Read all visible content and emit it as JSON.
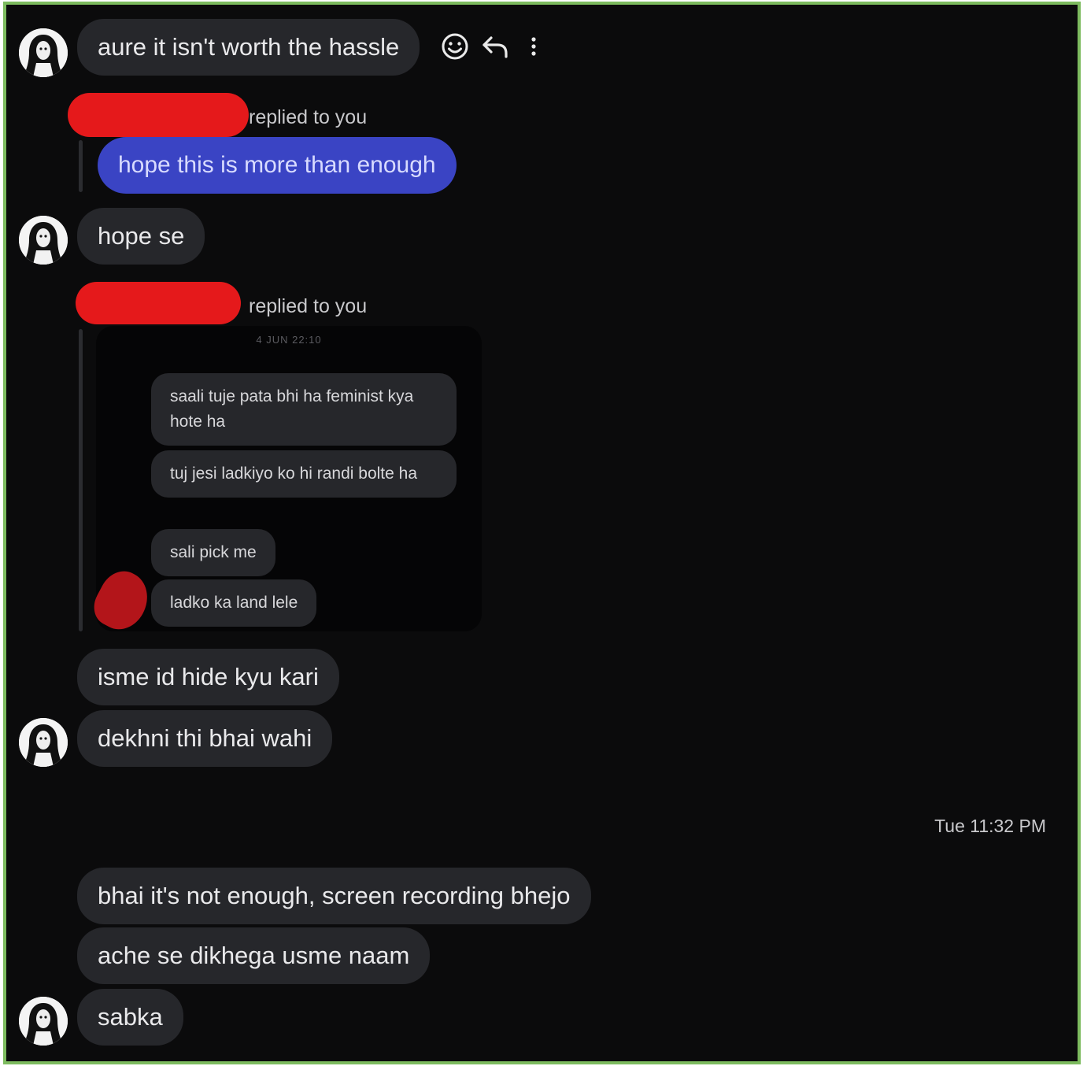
{
  "messages": {
    "m1": "aure it isn't worth the hassle",
    "reply1_label": "replied to you",
    "reply1_text": "hope this is more than enough",
    "m2": "hope se",
    "reply2_label": "replied to you",
    "m3": "isme id hide kyu kari",
    "m4": "dekhni thi bhai wahi",
    "m5": "bhai it's not enough, screen recording bhejo",
    "m6": "ache se dikhega usme naam",
    "m7": "sabka"
  },
  "quoted_screenshot": {
    "stamp": "4 JUN 22:10",
    "q1": "saali tuje pata bhi ha feminist kya hote ha",
    "q2": "tuj jesi ladkiyo ko hi randi bolte ha",
    "q3": "sali pick me",
    "q4": "ladko ka land lele"
  },
  "timestamp": "Tue 11:32 PM",
  "icons": {
    "react": "smiley-icon",
    "reply": "reply-arrow-icon",
    "more": "more-vertical-icon"
  },
  "colors": {
    "background": "#0b0b0c",
    "bubble": "#26272b",
    "sent_bubble": "#3a44c4",
    "redaction": "#e5191b",
    "frame_border": "#7dbb5f"
  }
}
